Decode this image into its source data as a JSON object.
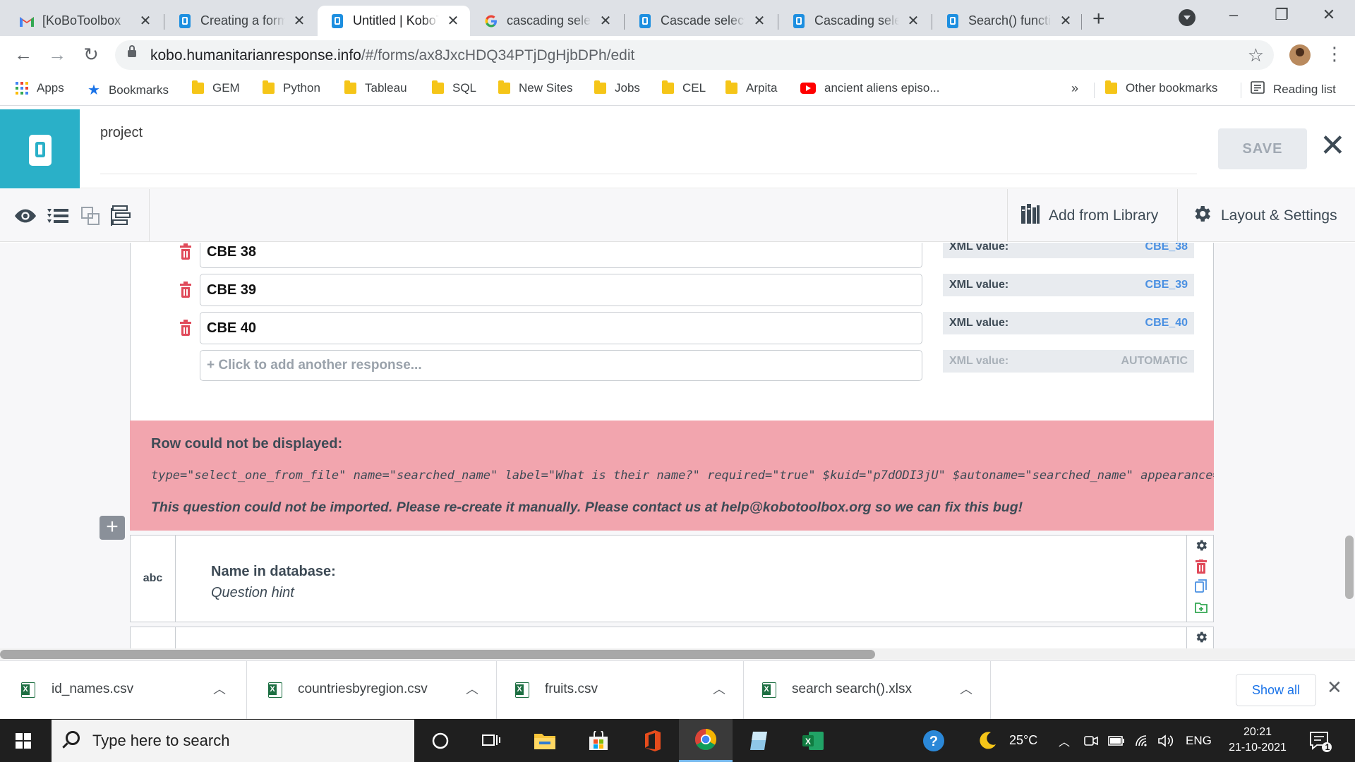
{
  "browser": {
    "tabs": [
      {
        "title": "[KoBoToolbox",
        "icon": "gmail-icon"
      },
      {
        "title": "Creating a form",
        "icon": "kobo-icon"
      },
      {
        "title": "Untitled | KoboToolbox",
        "icon": "kobo-icon",
        "active": true
      },
      {
        "title": "cascading select",
        "icon": "google-icon"
      },
      {
        "title": "Cascade select",
        "icon": "kobo-icon"
      },
      {
        "title": "Cascading select",
        "icon": "kobo-icon"
      },
      {
        "title": "Search() function",
        "icon": "kobo-icon"
      }
    ],
    "url_host": "kobo.humanitarianresponse.info",
    "url_path": "/#/forms/ax8JxcHDQ34PTjDgHjbDPh/edit",
    "bookmarks": [
      {
        "label": "Apps",
        "icon": "apps-grid-icon"
      },
      {
        "label": "Bookmarks",
        "icon": "star-icon"
      },
      {
        "label": "GEM",
        "icon": "folder-icon"
      },
      {
        "label": "Python",
        "icon": "folder-icon"
      },
      {
        "label": "Tableau",
        "icon": "folder-icon"
      },
      {
        "label": "SQL",
        "icon": "folder-icon"
      },
      {
        "label": "New Sites",
        "icon": "folder-icon"
      },
      {
        "label": "Jobs",
        "icon": "folder-icon"
      },
      {
        "label": "CEL",
        "icon": "folder-icon"
      },
      {
        "label": "Arpita",
        "icon": "folder-icon"
      },
      {
        "label": "ancient aliens episo...",
        "icon": "youtube-icon"
      }
    ],
    "overflow": "»",
    "other_bookmarks": "Other bookmarks",
    "reading_list": "Reading list"
  },
  "kobo": {
    "project_title": "project",
    "save_label": "SAVE",
    "add_from_library": "Add from Library",
    "layout_settings": "Layout & Settings",
    "choices": [
      {
        "label": "CBE 38",
        "xml_label": "XML value:",
        "xml_value": "CBE_38"
      },
      {
        "label": "CBE 39",
        "xml_label": "XML value:",
        "xml_value": "CBE_39"
      },
      {
        "label": "CBE 40",
        "xml_label": "XML value:",
        "xml_value": "CBE_40"
      }
    ],
    "add_response": {
      "label": "+ Click to add another response...",
      "xml_label": "XML value:",
      "xml_value": "AUTOMATIC"
    },
    "error": {
      "title": "Row could not be displayed:",
      "code": "type=\"select_one_from_file\" name=\"searched_name\" label=\"What is their name?\" required=\"true\" $kuid=\"p7dODI3jU\" $autoname=\"searched_name\" appearance=\"search se",
      "message": "This question could not be imported. Please re-create it manually. Please contact us at help@kobotoolbox.org so we can fix this bug!"
    },
    "question": {
      "type": "abc",
      "name_label": "Name in database:",
      "hint": "Question hint"
    }
  },
  "downloads": {
    "items": [
      "id_names.csv",
      "countriesbyregion.csv",
      "fruits.csv",
      "search search().xlsx"
    ],
    "show_all": "Show all"
  },
  "taskbar": {
    "search_placeholder": "Type here to search",
    "weather": "25°C",
    "language": "ENG",
    "time": "20:21",
    "date": "21-10-2021",
    "notifications": "1"
  },
  "colors": {
    "kobo_teal": "#2ab0c8",
    "error_pink": "#f2a5ae",
    "xml_blue": "#4a90e2",
    "trash_red": "#e04a5a"
  }
}
